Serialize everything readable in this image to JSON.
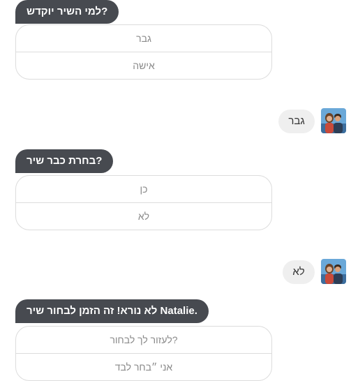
{
  "conversation": {
    "q1": {
      "question": "למי השיר יוקדש?",
      "options": [
        "גבר",
        "אישה"
      ]
    },
    "a1": {
      "text": "גבר",
      "avatar_icon": "couple-photo"
    },
    "q2": {
      "question": "בחרת כבר שיר?",
      "options": [
        "כן",
        "לא"
      ]
    },
    "a2": {
      "text": "לא",
      "avatar_icon": "couple-photo"
    },
    "q3": {
      "question": "לא נורא! זה הזמן לבחור שיר Natalie.",
      "options": [
        "לעזור לך לבחור?",
        "אני ״בחר לבד"
      ]
    }
  },
  "colors": {
    "bot_bubble": "#474a50",
    "user_bubble": "#efefef",
    "option_border": "#dcdcdc",
    "option_text": "#8a8a8a"
  }
}
